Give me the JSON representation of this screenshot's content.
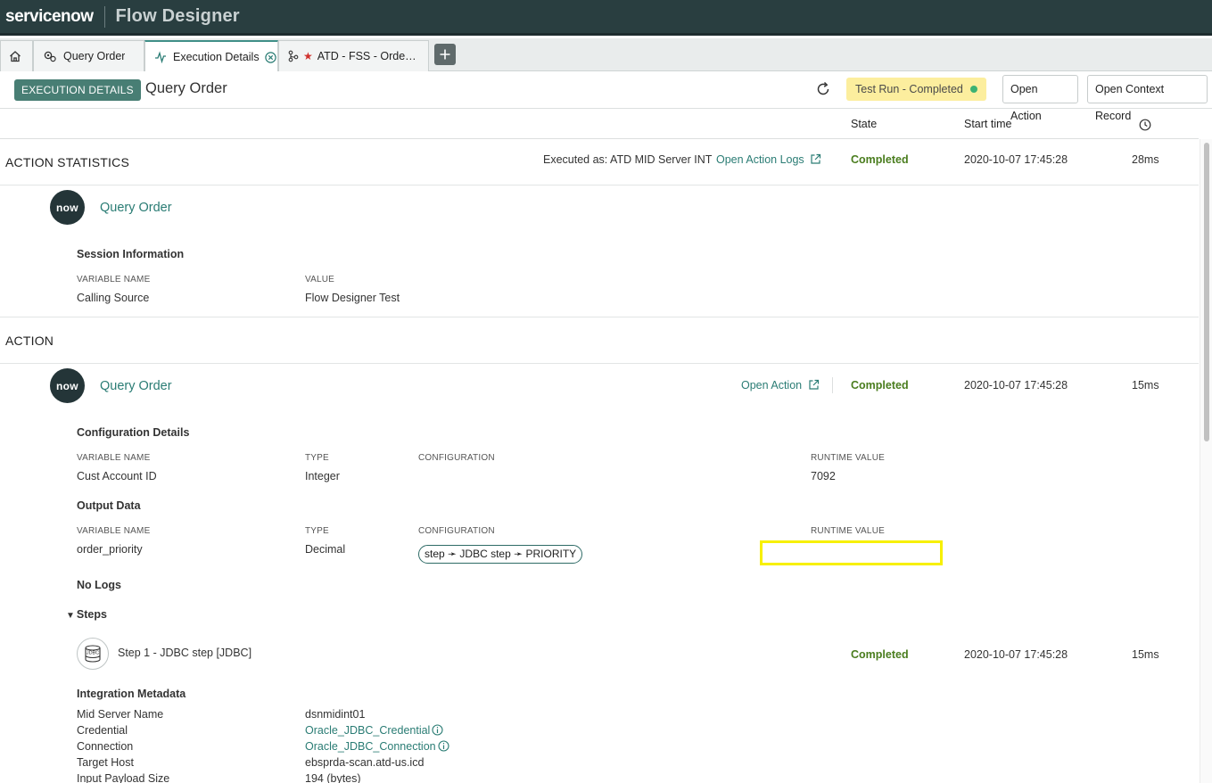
{
  "header": {
    "logo": "servicenow",
    "app_title": "Flow Designer"
  },
  "tabs": [
    {
      "label": "Query Order"
    },
    {
      "label": "Execution Details"
    },
    {
      "label": "ATD - FSS - Orde…"
    }
  ],
  "page": {
    "badge": "EXECUTION DETAILS",
    "title": "Query Order",
    "status": "Test Run - Completed",
    "open_action_btn": "Open Action",
    "open_context_btn": "Open Context Record"
  },
  "columns": {
    "state": "State",
    "start_time": "Start time"
  },
  "action_statistics": {
    "heading": "ACTION STATISTICS",
    "executed_as": "Executed as: ATD MID Server INT",
    "logs_link": "Open Action Logs",
    "state": "Completed",
    "start": "2020-10-07 17:45:28",
    "duration": "28ms",
    "logo_text": "now",
    "name": "Query Order",
    "session_heading": "Session Information",
    "var_cap": "VARIABLE NAME",
    "value_cap": "VALUE",
    "var_name": "Calling Source",
    "var_value": "Flow Designer Test"
  },
  "action": {
    "heading": "ACTION",
    "logo_text": "now",
    "name": "Query Order",
    "open_link": "Open Action",
    "state": "Completed",
    "start": "2020-10-07 17:45:28",
    "duration": "15ms",
    "config_heading": "Configuration Details",
    "cap_var": "VARIABLE NAME",
    "cap_type": "TYPE",
    "cap_config": "CONFIGURATION",
    "cap_runtime": "RUNTIME VALUE",
    "config_row": {
      "name": "Cust Account ID",
      "type": "Integer",
      "runtime": "7092"
    },
    "output_heading": "Output Data",
    "output_row": {
      "name": "order_priority",
      "type": "Decimal",
      "config": "step ➛ JDBC step ➛ PRIORITY",
      "runtime": ""
    },
    "no_logs": "No Logs",
    "steps_heading": "Steps",
    "step": {
      "icon_text": "JDBC",
      "name": "Step 1 - JDBC step [JDBC]",
      "state": "Completed",
      "start": "2020-10-07 17:45:28",
      "duration": "15ms"
    },
    "integration_heading": "Integration Metadata",
    "metadata": [
      {
        "label": "Mid Server Name",
        "value": "dsnmidint01"
      },
      {
        "label": "Credential",
        "value": "Oracle_JDBC_Credential"
      },
      {
        "label": "Connection",
        "value": "Oracle_JDBC_Connection"
      },
      {
        "label": "Target Host",
        "value": "ebsprda-scan.atd-us.icd"
      },
      {
        "label": "Input Payload Size",
        "value": "194 (bytes)"
      }
    ]
  }
}
